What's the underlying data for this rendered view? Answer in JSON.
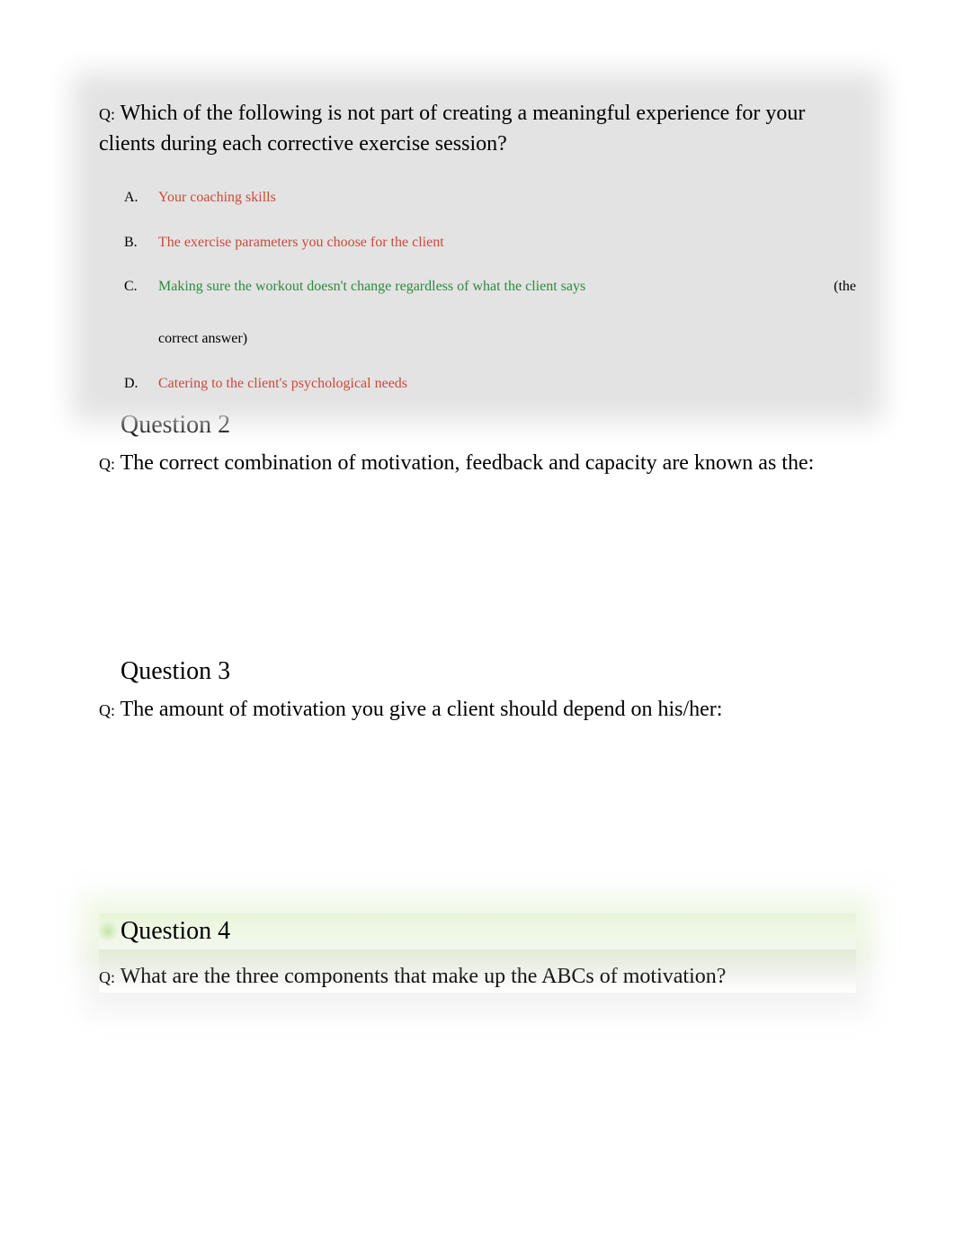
{
  "q1": {
    "prompt_label": "Q:",
    "prompt_text": "Which of the following is not part of creating a meaningful experience for your clients during each corrective exercise session?",
    "answers": {
      "a": {
        "letter": "A.",
        "text": "Your coaching skills"
      },
      "b": {
        "letter": "B.",
        "text": "The exercise parameters you choose for the client"
      },
      "c": {
        "letter": "C.",
        "text": "Making sure the workout doesn't change regardless of what the client says",
        "note_open": "(the",
        "note_close": "correct answer)"
      },
      "d": {
        "letter": "D.",
        "text": "Catering to the client's psychological needs"
      }
    }
  },
  "q2": {
    "header": "Question 2",
    "prompt_label": "Q:",
    "prompt_text": "The correct combination of motivation, feedback and capacity are known as the:"
  },
  "q3": {
    "header": "Question 3",
    "prompt_label": "Q:",
    "prompt_text": "The amount of motivation you give a client should depend on his/her:"
  },
  "q4": {
    "header": "Question 4",
    "prompt_label": "Q:",
    "prompt_text": "What are the three components that make up the ABCs of motivation?"
  }
}
